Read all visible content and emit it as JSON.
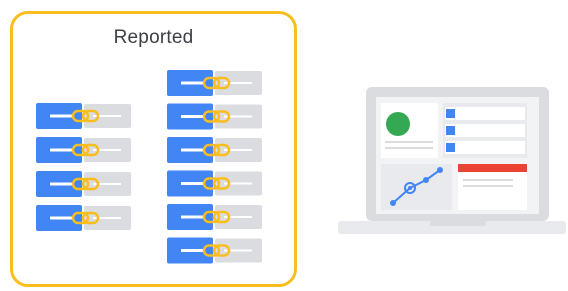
{
  "group": {
    "title": "Reported",
    "border_color": "#F9BE1D"
  },
  "colors": {
    "blue": "#4285F4",
    "gray": "#DADCE0",
    "yellow": "#F9BE1D",
    "green": "#34A853",
    "red": "#EA4335",
    "white": "#FFFFFF",
    "laptop_body": "#DADCE0",
    "laptop_base": "#E8EAED",
    "screen_bg": "#F1F3F4",
    "panel": "#E8EAED"
  },
  "left_column_links": 4,
  "right_column_links": 6,
  "link_icon": "chain-link-icon",
  "laptop": {
    "icon": "laptop-dashboard-icon",
    "widgets": [
      "profile-card",
      "list-panel",
      "line-chart-panel",
      "alert-panel"
    ]
  }
}
